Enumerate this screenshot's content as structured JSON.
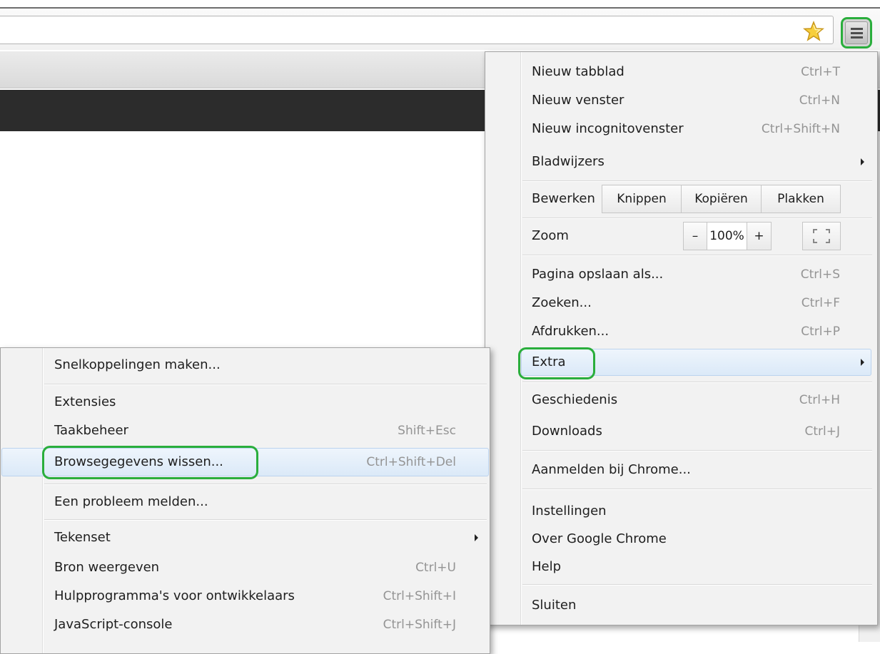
{
  "toolbar": {
    "bookmark_icon": "star-icon",
    "menu_icon": "hamburger-menu-icon"
  },
  "main_menu": {
    "items": [
      {
        "label": "Nieuw tabblad",
        "shortcut": "Ctrl+T"
      },
      {
        "label": "Nieuw venster",
        "shortcut": "Ctrl+N"
      },
      {
        "label": "Nieuw incognitovenster",
        "shortcut": "Ctrl+Shift+N"
      },
      {
        "label": "Bladwijzers",
        "shortcut": ""
      }
    ],
    "edit": {
      "label": "Bewerken",
      "cut": "Knippen",
      "copy": "Kopiëren",
      "paste": "Plakken"
    },
    "zoom": {
      "label": "Zoom",
      "minus": "–",
      "value": "100%",
      "plus": "+"
    },
    "page_items": [
      {
        "label": "Pagina opslaan als...",
        "shortcut": "Ctrl+S"
      },
      {
        "label": "Zoeken...",
        "shortcut": "Ctrl+F"
      },
      {
        "label": "Afdrukken...",
        "shortcut": "Ctrl+P"
      },
      {
        "label": "Extra",
        "shortcut": ""
      }
    ],
    "history_items": [
      {
        "label": "Geschiedenis",
        "shortcut": "Ctrl+H"
      },
      {
        "label": "Downloads",
        "shortcut": "Ctrl+J"
      }
    ],
    "signin": "Aanmelden bij Chrome...",
    "settings_items": [
      {
        "label": "Instellingen"
      },
      {
        "label": "Over Google Chrome"
      },
      {
        "label": "Help"
      }
    ],
    "quit": "Sluiten"
  },
  "sub_menu": {
    "items": [
      {
        "label": "Snelkoppelingen maken...",
        "shortcut": ""
      },
      {
        "label": "Extensies",
        "shortcut": ""
      },
      {
        "label": "Taakbeheer",
        "shortcut": "Shift+Esc"
      },
      {
        "label": "Browsegegevens wissen...",
        "shortcut": "Ctrl+Shift+Del"
      },
      {
        "label": "Een probleem melden...",
        "shortcut": ""
      },
      {
        "label": "Tekenset",
        "shortcut": ""
      },
      {
        "label": "Bron weergeven",
        "shortcut": "Ctrl+U"
      },
      {
        "label": "Hulpprogramma's voor ontwikkelaars",
        "shortcut": "Ctrl+Shift+I"
      },
      {
        "label": "JavaScript-console",
        "shortcut": "Ctrl+Shift+J"
      }
    ]
  },
  "colors": {
    "highlight_ring": "#2aae3c",
    "menu_bg": "#f2f2f2",
    "hover_bg": "#dbe9f8"
  }
}
